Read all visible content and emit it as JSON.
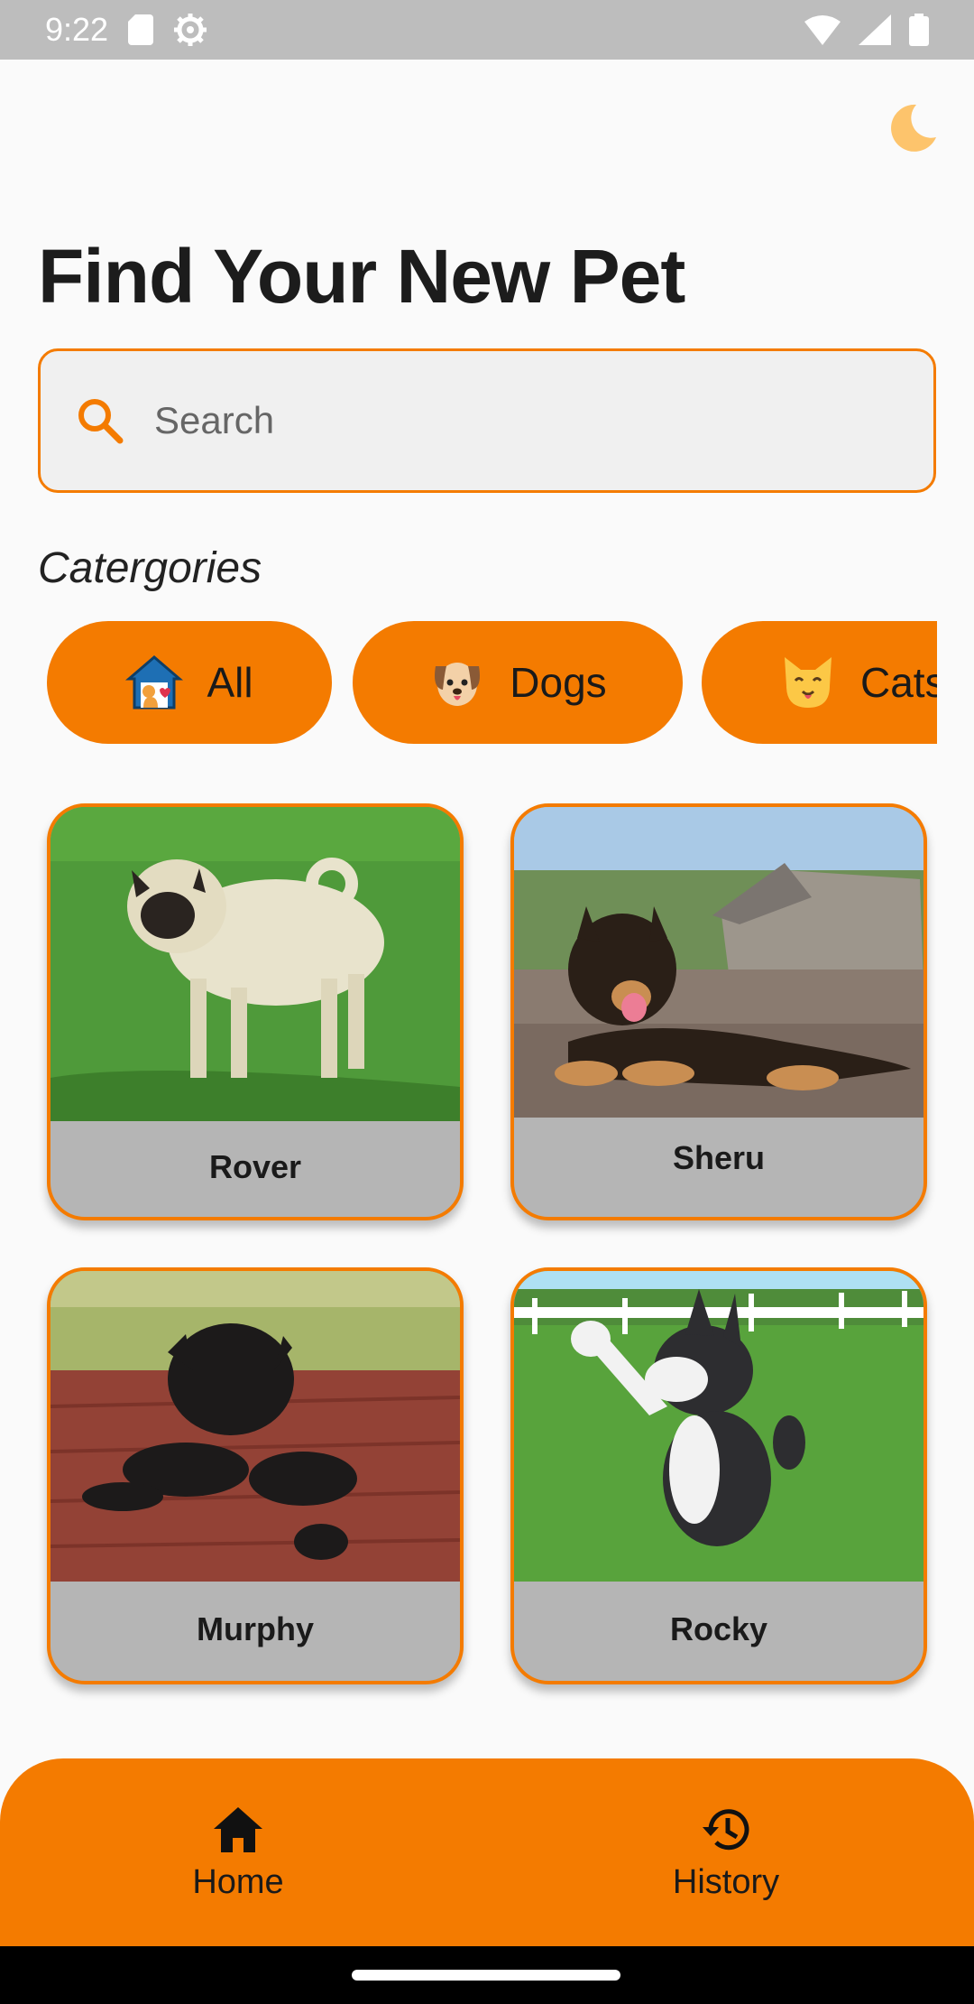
{
  "status_bar": {
    "time": "9:22",
    "icons": [
      "sd-card-icon",
      "settings-gear-icon",
      "wifi-icon",
      "cell-signal-icon",
      "battery-icon"
    ]
  },
  "header": {
    "theme_toggle_icon": "moon-icon",
    "title": "Find Your New Pet"
  },
  "search": {
    "placeholder": "Search",
    "value": "",
    "icon": "search-icon"
  },
  "categories": {
    "label": "Catergories",
    "items": [
      {
        "label": "All",
        "icon": "pet-house-icon"
      },
      {
        "label": "Dogs",
        "icon": "dog-face-icon"
      },
      {
        "label": "Cats",
        "icon": "cat-face-icon"
      }
    ]
  },
  "pets": [
    {
      "name": "Rover",
      "photo": "pug-fawn-photo"
    },
    {
      "name": "Sheru",
      "photo": "german-shepherd-puppy-photo"
    },
    {
      "name": "Murphy",
      "photo": "black-pug-photo"
    },
    {
      "name": "Rocky",
      "photo": "husky-puppy-photo"
    }
  ],
  "bottom_nav": {
    "items": [
      {
        "label": "Home",
        "icon": "home-icon"
      },
      {
        "label": "History",
        "icon": "history-icon"
      }
    ]
  },
  "colors": {
    "accent": "#f47b00",
    "background": "#fafafa",
    "card_label_bg": "#b5b5b5",
    "status_bar": "#bdbdbd"
  }
}
